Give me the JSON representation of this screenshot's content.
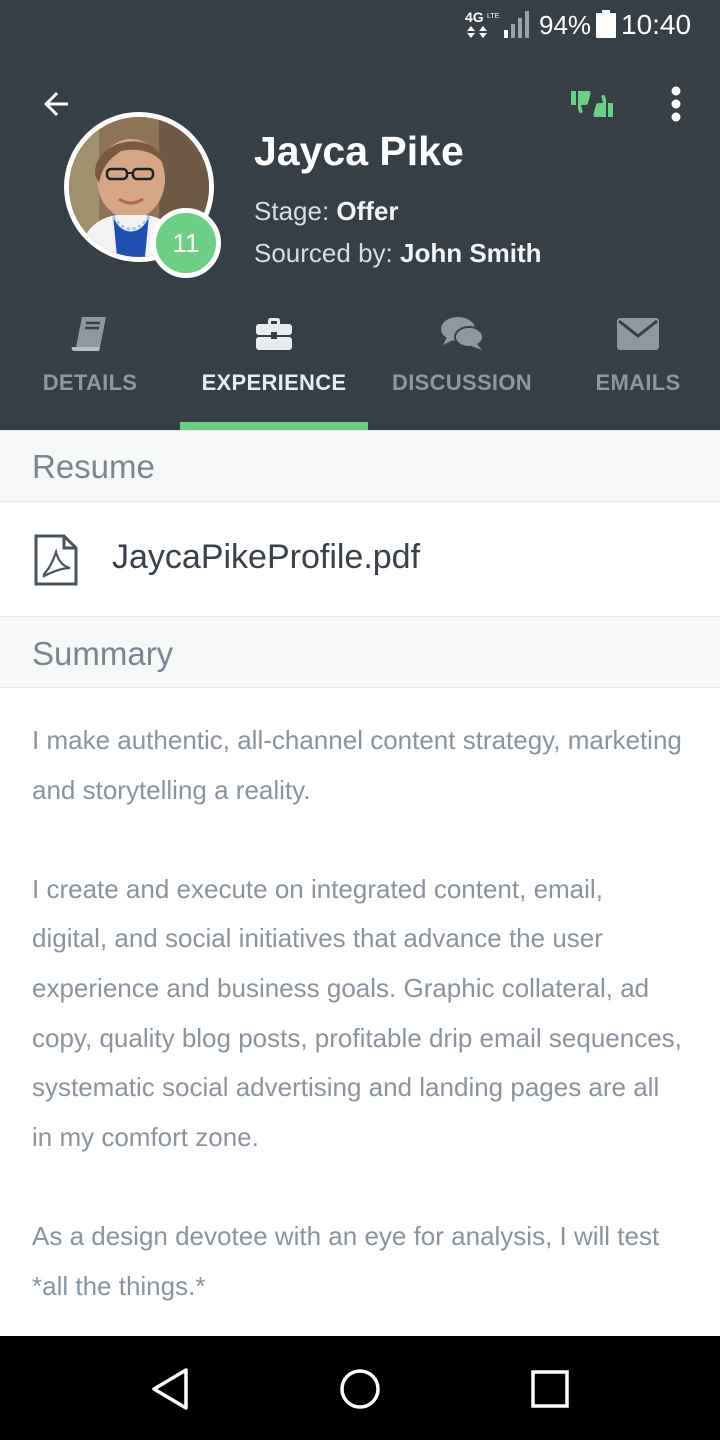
{
  "status_bar": {
    "network": "4G",
    "battery_percent": "94%",
    "time": "10:40"
  },
  "candidate": {
    "name": "Jayca Pike",
    "badge_count": "11",
    "stage_label": "Stage:",
    "stage_value": "Offer",
    "sourced_label": "Sourced by:",
    "sourced_value": "John Smith"
  },
  "header_actions": {
    "back": "arrow-left-icon",
    "rating": "thumbs-up-down-icon",
    "more": "more-vertical-icon"
  },
  "tabs": [
    {
      "label": "DETAILS",
      "icon": "book-icon",
      "active": false
    },
    {
      "label": "EXPERIENCE",
      "icon": "briefcase-icon",
      "active": true
    },
    {
      "label": "DISCUSSION",
      "icon": "chat-bubbles-icon",
      "active": false
    },
    {
      "label": "EMAILS",
      "icon": "envelope-icon",
      "active": false
    }
  ],
  "resume": {
    "heading": "Resume",
    "file_name": "JaycaPikeProfile.pdf",
    "file_icon": "pdf-file-icon"
  },
  "summary": {
    "heading": "Summary",
    "paragraphs": [
      "I make authentic, all-channel content strategy, marketing and storytelling a reality.",
      "I create and execute on integrated content, email, digital, and social initiatives that advance the user experience and business goals. Graphic collateral, ad copy, quality blog posts, profitable drip email sequences, systematic social advertising and landing pages are all in my comfort zone.",
      "As a design devotee with an eye for analysis, I will test *all the things.*"
    ]
  },
  "colors": {
    "header_bg": "#363e46",
    "accent_green": "#6dcf86",
    "tab_inactive": "#8f98a1",
    "body_text": "#8a949e"
  }
}
